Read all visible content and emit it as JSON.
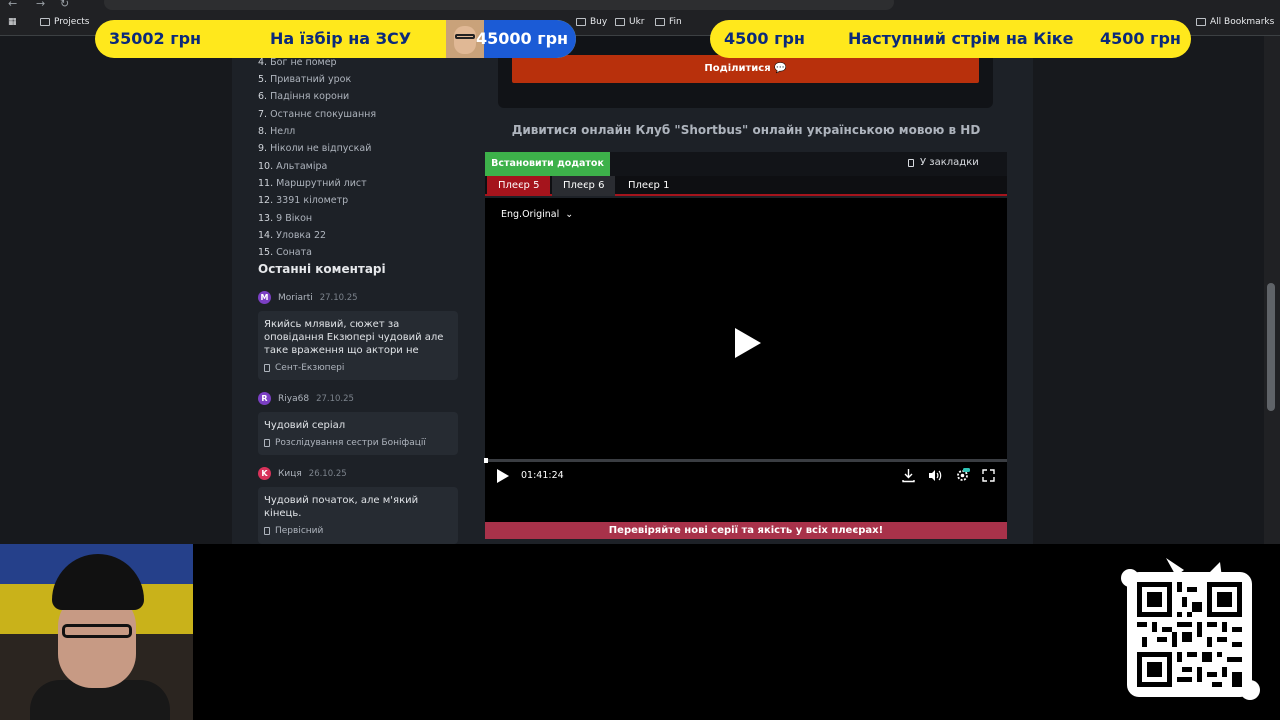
{
  "bookmarks": [
    {
      "label": "Projects"
    },
    {
      "label": "Buy"
    },
    {
      "label": "Ukr"
    },
    {
      "label": "Fin"
    },
    {
      "label": "All Bookmarks"
    }
  ],
  "overlay": {
    "left_amount": "35002 грн",
    "left_title": "На їзбір на ЗСУ",
    "left_goal": "45000 грн",
    "right_amount": "4500 грн",
    "right_title": "Наступний стрім на Кіке",
    "right_goal": "4500 грн"
  },
  "sidebar": {
    "episodes": [
      {
        "num": "4.",
        "title": "Бог не помер"
      },
      {
        "num": "5.",
        "title": "Приватний урок"
      },
      {
        "num": "6.",
        "title": "Падіння корони"
      },
      {
        "num": "7.",
        "title": "Останнє спокушання"
      },
      {
        "num": "8.",
        "title": "Нелл"
      },
      {
        "num": "9.",
        "title": "Ніколи не відпускай"
      },
      {
        "num": "10.",
        "title": "Альтаміра"
      },
      {
        "num": "11.",
        "title": "Маршрутний лист"
      },
      {
        "num": "12.",
        "title": "3391 кілометр"
      },
      {
        "num": "13.",
        "title": "9 Вікон"
      },
      {
        "num": "14.",
        "title": "Уловка 22"
      },
      {
        "num": "15.",
        "title": "Соната"
      }
    ],
    "comments_title": "Останні коментарі",
    "comments": [
      {
        "initial": "M",
        "user": "Moriarti",
        "date": "27.10.25",
        "color": "#7b3fc4",
        "text": "Якийсь млявий, сюжет за оповідання Екзюпері чудовий але таке враження що актори не",
        "film": "Сент-Екзюпері"
      },
      {
        "initial": "R",
        "user": "Riya68",
        "date": "27.10.25",
        "color": "#7b3fc4",
        "text": "Чудовий серіал",
        "film": "Розслідування сестри Боніфації"
      },
      {
        "initial": "K",
        "user": "Киця",
        "date": "26.10.25",
        "color": "#d8325a",
        "text": "Чудовий початок, але м'який кінець.",
        "film": "Первісний"
      }
    ]
  },
  "main": {
    "share_label": "Поділитися 💬",
    "watch_title": "Дивитися онлайн Клуб \"Shortbus\" онлайн українською мовою в HD",
    "install_label": "Встановити додаток",
    "bookmark_label": "У закладки",
    "players": [
      {
        "label": "Плеєр 5"
      },
      {
        "label": "Плеєр 6"
      },
      {
        "label": "Плеєр 1"
      }
    ],
    "audio_track": "Eng.Original",
    "time": "01:41:24",
    "progress": 0.002,
    "notice": "Перевіряйте нові серії та якість у всіх плеєрах!"
  },
  "colors": {
    "accent_red": "#a5141c",
    "install_green": "#3db14a",
    "share_orange": "#b8300c",
    "banner_yellow": "#ffe81c"
  }
}
